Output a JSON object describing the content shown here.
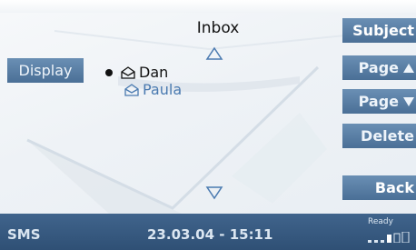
{
  "screen": {
    "title": "Inbox"
  },
  "left_button": {
    "label": "Display"
  },
  "softkeys": [
    {
      "label": "Subject",
      "icon": ""
    },
    {
      "label": "Page",
      "icon": "triangle-up"
    },
    {
      "label": "Page",
      "icon": "triangle-down"
    },
    {
      "label": "Delete",
      "icon": ""
    },
    {
      "label": "Back",
      "icon": ""
    }
  ],
  "messages": [
    {
      "sender": "Dan",
      "selected": true,
      "icon": "envelope-open-icon"
    },
    {
      "sender": "Paula",
      "selected": false,
      "icon": "envelope-open-icon"
    }
  ],
  "status_bar": {
    "mode": "SMS",
    "datetime": "23.03.04 - 15:11",
    "network_status": "Ready"
  },
  "colors": {
    "button_blue": "#5a7fa6",
    "status_bar": "#3a5c83",
    "unselected_text": "#4a7ab0"
  }
}
